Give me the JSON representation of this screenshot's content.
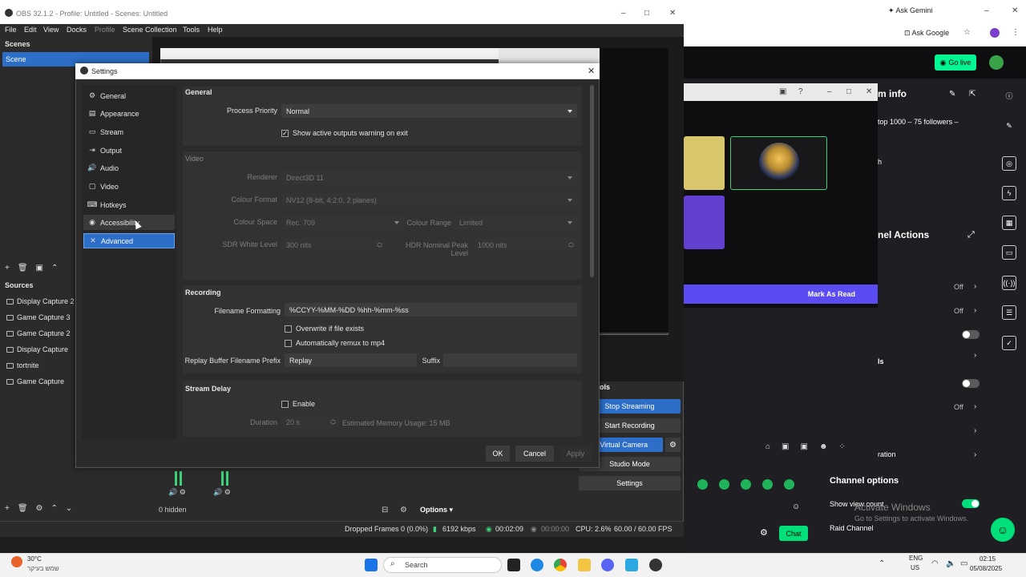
{
  "obs": {
    "title": "OBS 32.1.2 - Profile: Untitled - Scenes: Untitled",
    "menu": [
      "File",
      "Edit",
      "View",
      "Docks",
      "Profile",
      "Scene Collection",
      "Tools",
      "Help"
    ],
    "scenes_header": "Scenes",
    "scenes": [
      "Scene"
    ],
    "sources_header": "Sources",
    "sources": [
      "Display Capture 2",
      "Game Capture 3",
      "Game Capture 2",
      "Display Capture",
      "tortnite",
      "Game Capture"
    ],
    "controls_header_fragment": "ols",
    "controls": [
      "Stop Streaming",
      "Start Recording",
      "o Virtual Camera",
      "Studio Mode",
      "Settings"
    ],
    "hidden_count": "0 hidden",
    "options_label": "Options",
    "status": {
      "dropped_frames": "Dropped Frames 0 (0.0%)",
      "bitrate": "6192 kbps",
      "stream_time": "00:02:09",
      "rec_time": "00:00:00",
      "cpu": "CPU: 2.6%",
      "fps": "60.00 / 60.00 FPS"
    }
  },
  "settings": {
    "title": "Settings",
    "nav": [
      {
        "label": "General",
        "icon": "gear-icon",
        "glyph": "⚙"
      },
      {
        "label": "Appearance",
        "icon": "appearance-icon",
        "glyph": "▤"
      },
      {
        "label": "Stream",
        "icon": "stream-icon",
        "glyph": "▭"
      },
      {
        "label": "Output",
        "icon": "output-icon",
        "glyph": "⇥"
      },
      {
        "label": "Audio",
        "icon": "audio-icon",
        "glyph": "🔊"
      },
      {
        "label": "Video",
        "icon": "video-icon",
        "glyph": "▢"
      },
      {
        "label": "Hotkeys",
        "icon": "keyboard-icon",
        "glyph": "⌨"
      },
      {
        "label": "Accessibility",
        "icon": "accessibility-icon",
        "glyph": "◉"
      },
      {
        "label": "Advanced",
        "icon": "wrench-icon",
        "glyph": "✕"
      }
    ],
    "selected_nav": "Advanced",
    "general": {
      "title": "General",
      "process_priority_label": "Process Priority",
      "process_priority_value": "Normal",
      "show_warning_label": "Show active outputs warning on exit",
      "show_warning_checked": true
    },
    "video": {
      "title": "Video",
      "renderer_label": "Renderer",
      "renderer_value": "Direct3D 11",
      "colour_format_label": "Colour Format",
      "colour_format_value": "NV12 (8-bit, 4:2:0, 2 planes)",
      "colour_space_label": "Colour Space",
      "colour_space_value": "Rec. 709",
      "colour_range_label": "Colour Range",
      "colour_range_value": "Limited",
      "sdr_label": "SDR White Level",
      "sdr_value": "300 nits",
      "hdr_label": "HDR Nominal Peak Level",
      "hdr_value": "1000 nits"
    },
    "recording": {
      "title": "Recording",
      "filename_label": "Filename Formatting",
      "filename_value": "%CCYY-%MM-%DD %hh-%mm-%ss",
      "overwrite_label": "Overwrite if file exists",
      "remux_label": "Automatically remux to mp4",
      "prefix_label": "Replay Buffer Filename Prefix",
      "prefix_value": "Replay",
      "suffix_label": "Suffix",
      "suffix_value": ""
    },
    "stream_delay": {
      "title": "Stream Delay",
      "enable_label": "Enable",
      "duration_label": "Duration",
      "duration_value": "20 s",
      "memory_label": "Estimated Memory Usage: 15 MB"
    },
    "buttons": {
      "ok": "OK",
      "cancel": "Cancel",
      "apply": "Apply"
    }
  },
  "browser": {
    "ask_gemini": "Ask Gemini",
    "ask_google": "Ask Google",
    "go_live": "Go live",
    "info_title": "m info",
    "info_text": "top 1000 – 75 followers –",
    "info_h": "h",
    "channel_actions": "nel Actions",
    "mark_as_read": "Mark As Read",
    "off_labels": [
      "Off",
      "Off",
      "Off"
    ],
    "ls_label": "ls",
    "ration_label": "ration",
    "channel_options": "Channel options",
    "show_view_count": "Show view count",
    "raid_channel": "Raid Channel",
    "chat": "Chat",
    "activate_windows": "Activate Windows",
    "activate_windows_sub": "Go to Settings to activate Windows."
  },
  "taskbar": {
    "weather_temp": "30°C",
    "weather_sub": "שמש בעיקר",
    "search": "Search",
    "lang1": "ENG",
    "lang2": "US",
    "time": "02:15",
    "date": "05/08/2025"
  }
}
